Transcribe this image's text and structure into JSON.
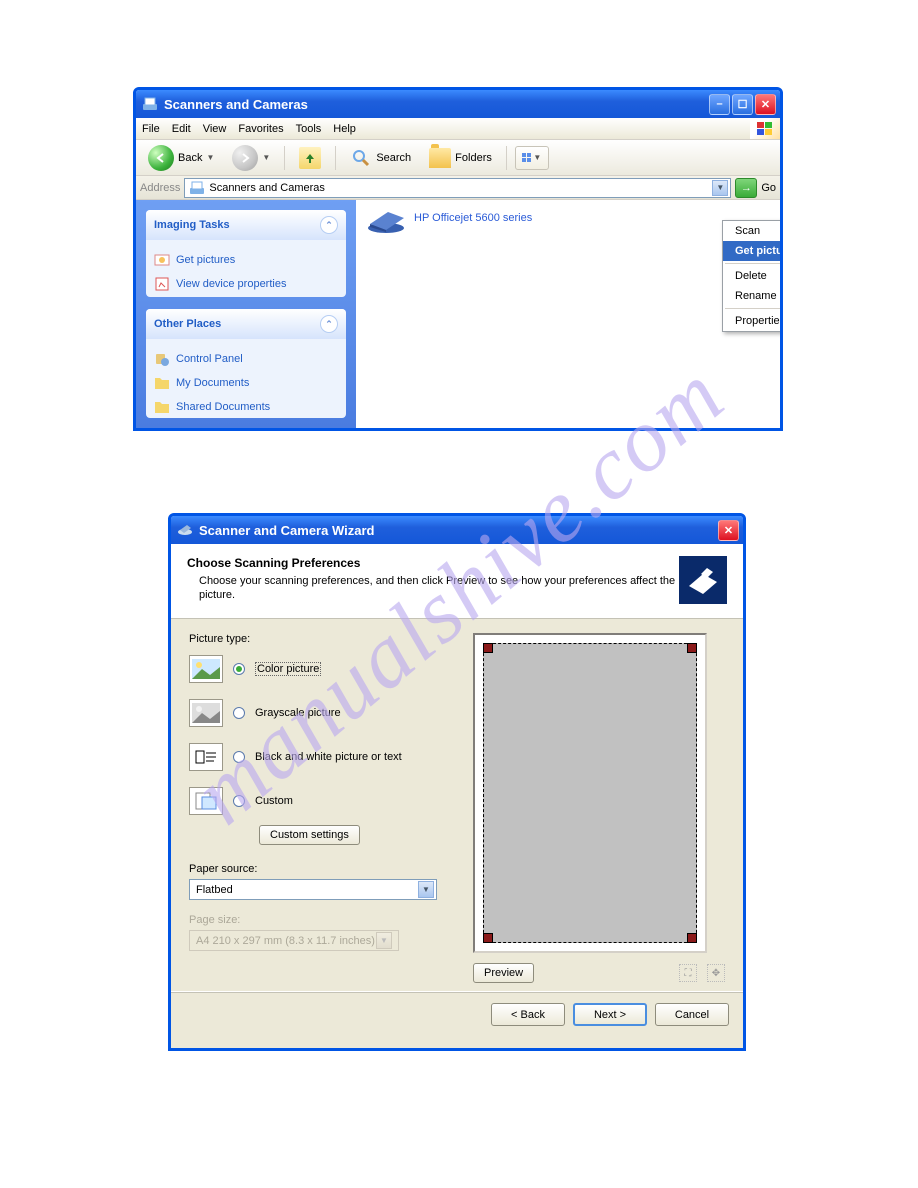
{
  "watermark": "manualshive.com",
  "window1": {
    "title": "Scanners and Cameras",
    "menubar": [
      "File",
      "Edit",
      "View",
      "Favorites",
      "Tools",
      "Help"
    ],
    "toolbar": {
      "back": "Back",
      "search": "Search",
      "folders": "Folders"
    },
    "address": {
      "label": "Address",
      "value": "Scanners and Cameras",
      "go": "Go"
    },
    "sidebar": {
      "imaging": {
        "title": "Imaging Tasks",
        "items": [
          "Get pictures",
          "View device properties"
        ]
      },
      "other": {
        "title": "Other Places",
        "items": [
          "Control Panel",
          "My Documents",
          "Shared Documents"
        ]
      }
    },
    "device": "HP Officejet 5600 series",
    "context_menu": {
      "scan": "Scan",
      "get_picture": "Get picture using Scanner Wizard",
      "delete": "Delete",
      "rename": "Rename",
      "properties": "Properties"
    }
  },
  "window2": {
    "title": "Scanner and Camera Wizard",
    "header": {
      "heading": "Choose Scanning Preferences",
      "desc": "Choose your scanning preferences, and then click Preview to see how your preferences affect the picture."
    },
    "picture_type": {
      "label": "Picture type:",
      "color": "Color picture",
      "grayscale": "Grayscale picture",
      "bw": "Black and white picture or text",
      "custom": "Custom",
      "custom_settings": "Custom settings"
    },
    "paper_source": {
      "label": "Paper source:",
      "value": "Flatbed"
    },
    "page_size": {
      "label": "Page size:",
      "value": "A4 210 x 297 mm (8.3 x 11.7 inches)"
    },
    "preview_btn": "Preview",
    "footer": {
      "back": "< Back",
      "next": "Next >",
      "cancel": "Cancel"
    }
  }
}
